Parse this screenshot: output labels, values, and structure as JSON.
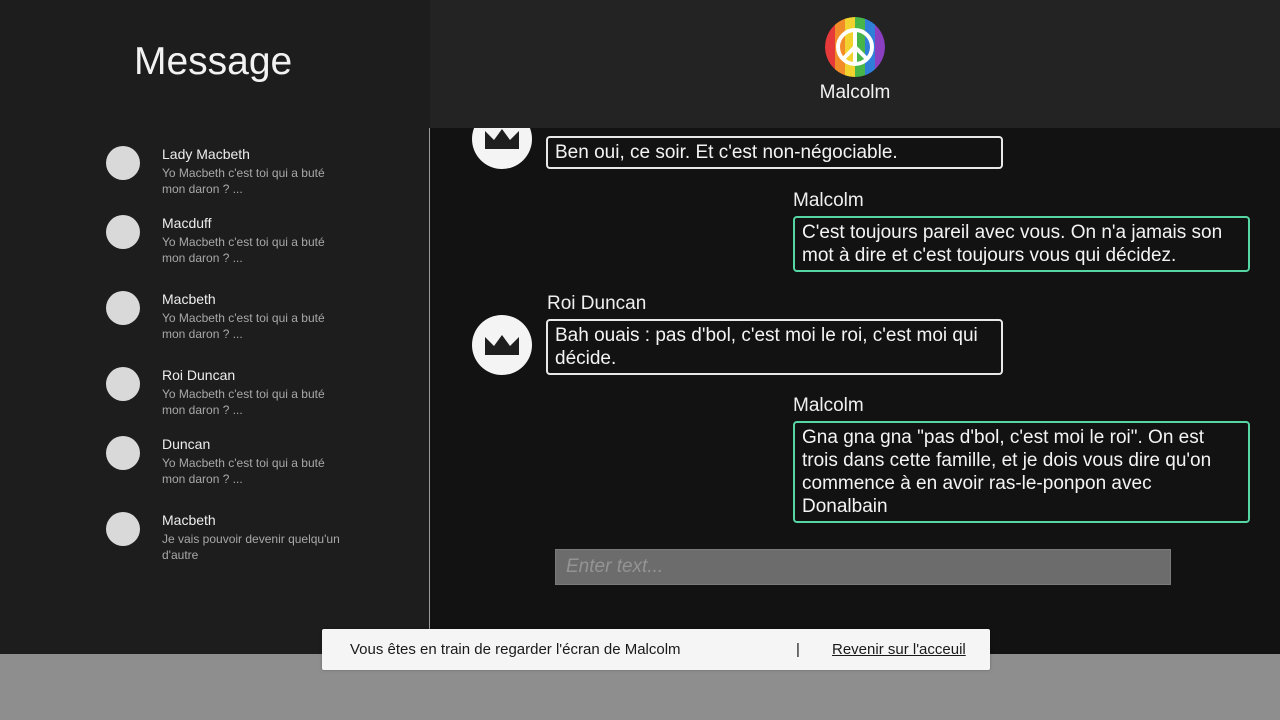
{
  "sidebar": {
    "title": "Message",
    "contacts": [
      {
        "name": "Lady Macbeth",
        "preview": "Yo Macbeth c'est toi qui a buté mon daron ? ..."
      },
      {
        "name": "Macduff",
        "preview": "Yo Macbeth c'est toi qui a buté mon daron ? ..."
      },
      {
        "name": "Macbeth",
        "preview": "Yo Macbeth c'est toi qui a buté mon daron ? ..."
      },
      {
        "name": "Roi Duncan",
        "preview": "Yo Macbeth c'est toi qui a buté mon daron ? ..."
      },
      {
        "name": "Duncan",
        "preview": "Yo Macbeth c'est toi qui a buté mon daron ? ..."
      },
      {
        "name": "Macbeth",
        "preview": "Je vais pouvoir devenir quelqu'un d'autre"
      }
    ]
  },
  "header": {
    "name": "Malcolm",
    "avatar_icon": "peace-sign-icon"
  },
  "messages": [
    {
      "sender": "",
      "text": "Ben oui, ce soir. Et c'est non-négociable.",
      "own": false,
      "avatar_icon": "crown-icon"
    },
    {
      "sender": "Malcolm",
      "text": "C'est toujours pareil avec vous. On n'a jamais son mot à dire et c'est toujours vous qui décidez.",
      "own": true
    },
    {
      "sender": "Roi Duncan",
      "text": "Bah ouais : pas d'bol, c'est moi le roi, c'est moi qui décide.",
      "own": false,
      "avatar_icon": "crown-icon"
    },
    {
      "sender": "Malcolm",
      "text": "Gna gna gna \"pas d'bol, c'est moi le roi\". On est trois dans cette famille, et je dois vous dire qu'on commence à en avoir ras-le-ponpon avec Donalbain",
      "own": true
    }
  ],
  "input": {
    "placeholder": "Enter text...",
    "value": ""
  },
  "notice": {
    "text": "Vous êtes en train de regarder l'écran de Malcolm",
    "separator": "|",
    "link_label": "Revenir sur l'acceuil"
  },
  "colors": {
    "own_bubble_border": "#56d6a3",
    "other_bubble_border": "#e8e8e8",
    "background": "#121212"
  }
}
